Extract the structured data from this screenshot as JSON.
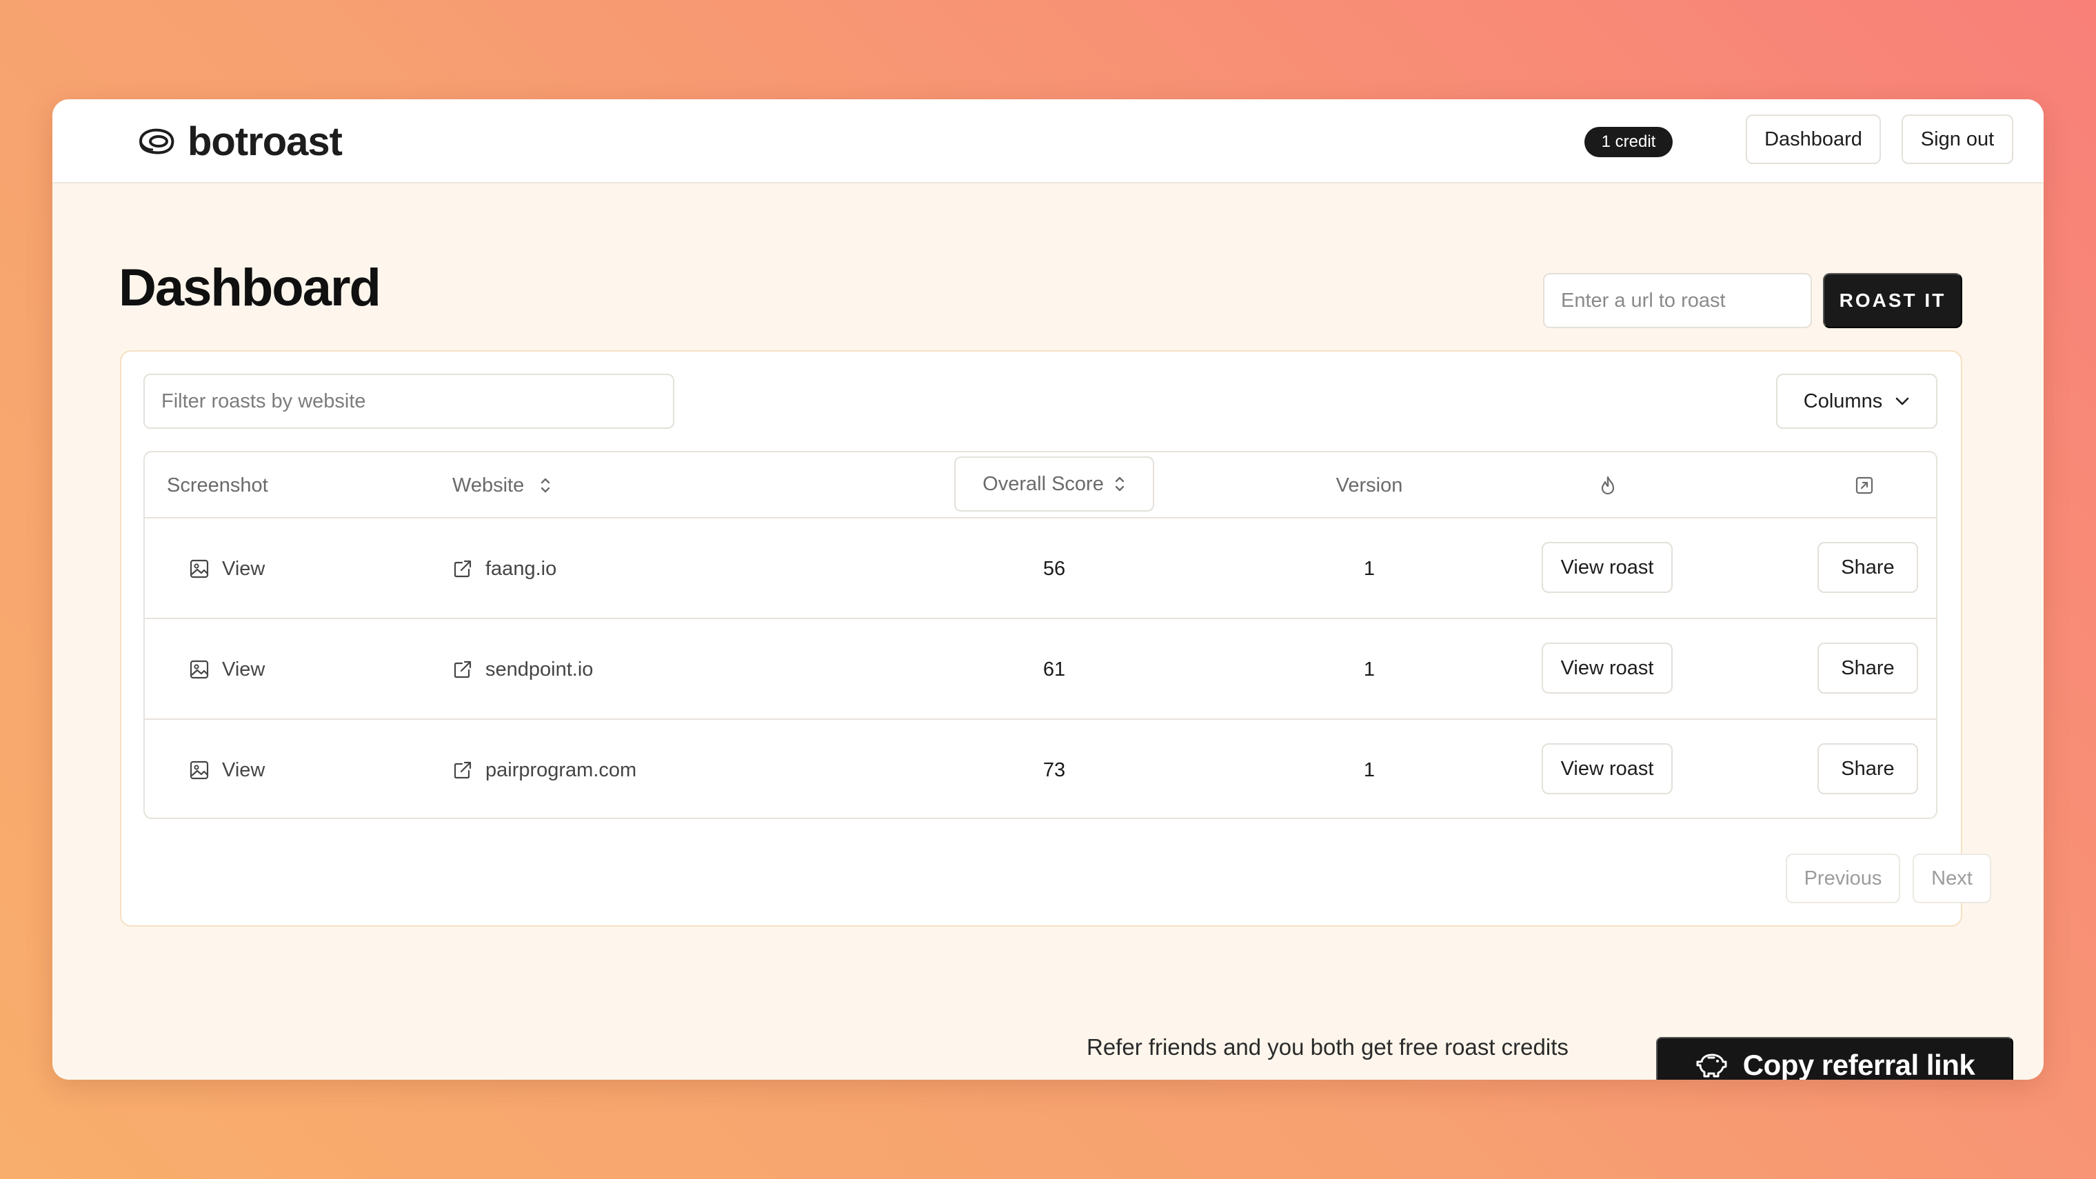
{
  "app": {
    "name": "botroast",
    "logo_icon": "steak-icon"
  },
  "header": {
    "credit_badge": "1 credit",
    "dashboard_button": "Dashboard",
    "signout_button": "Sign out"
  },
  "page": {
    "title": "Dashboard",
    "url_placeholder": "Enter a url to roast",
    "roast_button": "ROAST IT"
  },
  "table": {
    "filter_placeholder": "Filter roasts by website",
    "columns_button": "Columns",
    "headers": {
      "screenshot": "Screenshot",
      "website": "Website",
      "score": "Overall Score",
      "version": "Version",
      "roast_icon": "flame-icon",
      "share_icon": "external-square-icon"
    },
    "rows": [
      {
        "screenshot_label": "View",
        "website": "faang.io",
        "score": "56",
        "version": "1",
        "roast_button": "View roast",
        "share_button": "Share"
      },
      {
        "screenshot_label": "View",
        "website": "sendpoint.io",
        "score": "61",
        "version": "1",
        "roast_button": "View roast",
        "share_button": "Share"
      },
      {
        "screenshot_label": "View",
        "website": "pairprogram.com",
        "score": "73",
        "version": "1",
        "roast_button": "View roast",
        "share_button": "Share"
      }
    ],
    "pagination": {
      "previous": "Previous",
      "next": "Next"
    }
  },
  "referral": {
    "text": "Refer friends and you both get free roast credits",
    "button": "Copy referral link",
    "button_icon": "piggy-bank-icon"
  },
  "colors": {
    "background_gradient_start": "#f88079",
    "background_gradient_end": "#f8ae6c",
    "card_background": "#fef6ec",
    "primary_dark": "#1a1a1a",
    "panel_border": "#f5e0c2"
  }
}
